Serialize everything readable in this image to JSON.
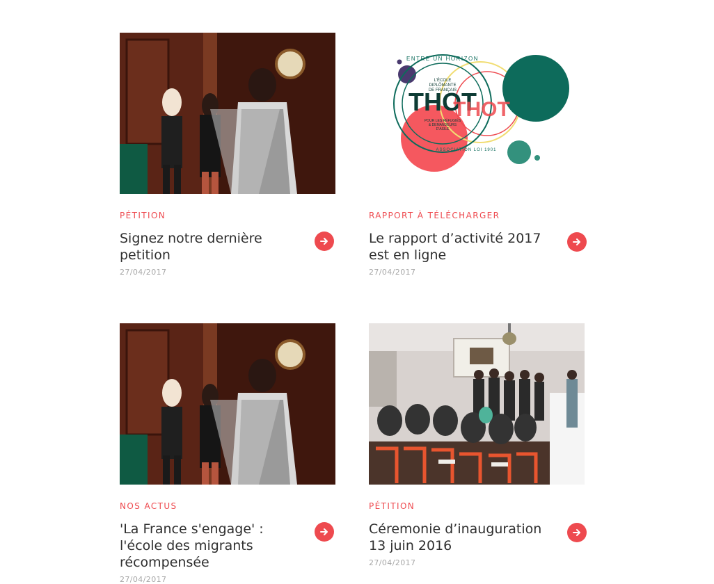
{
  "theme": {
    "accent": "#ee4a4f",
    "title_color": "#2f2f2f",
    "date_color": "#a7a7a7",
    "logo_colors": {
      "red": "#f5585f",
      "green": "#0d6b5b",
      "teal": "#33917d",
      "yellow": "#f1dd73",
      "purple": "#4a3a6f"
    }
  },
  "cards": [
    {
      "category": "PÉTITION",
      "title": "Signez notre dernière petition",
      "date": "27/04/2017",
      "image": "Photo: woman speaking at a lectern in an ornate wood-paneled room",
      "icon": "arrow-right-icon"
    },
    {
      "category": "RAPPORT À TÉLÉCHARGER",
      "title": "Le rapport d’activité 2017 est en ligne",
      "date": "27/04/2017",
      "image": "Thot association logo",
      "icon": "arrow-right-icon",
      "logo": {
        "word": "THOT",
        "ring_text": "ENTRE UN HORIZON",
        "inner_lines": [
          "L'ÉCOLE",
          "DIPLÔMANTE",
          "DE FRANÇAIS"
        ],
        "bottom_lines": [
          "POUR LES RÉFUGIÉS",
          "& DEMANDEURS",
          "D'ASILE"
        ],
        "footer_ring": "ASSOCIATION LOI 1901"
      }
    },
    {
      "category": "NOS ACTUS",
      "title": "'La France s'engage' : l'école des migrants récompensée",
      "date": "27/04/2017",
      "image": "Photo: woman speaking at a lectern in an ornate wood-paneled room",
      "icon": "arrow-right-icon"
    },
    {
      "category": "PÉTITION",
      "title": "Céremonie d’inauguration 13 juin 2016",
      "date": "27/04/2017",
      "image": "Photo: audience seated on orange chairs facing a group standing before a projection screen",
      "icon": "arrow-right-icon"
    }
  ]
}
